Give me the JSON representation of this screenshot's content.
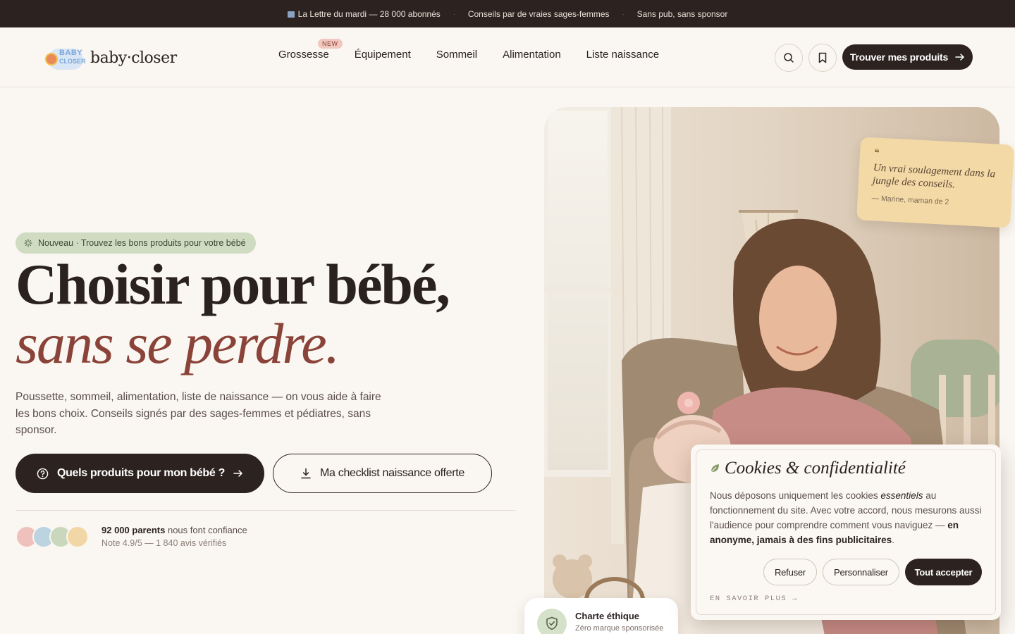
{
  "topbar": {
    "item1": "La Lettre du mardi — 28 000 abonnés",
    "item2": "Conseils par de vraies sages-femmes",
    "item3": "Sans pub, sans sponsor"
  },
  "brand": {
    "name": "baby·closer",
    "mark_line1": "BABY",
    "mark_line2": "CLOSER"
  },
  "nav": {
    "items": [
      "Grossesse",
      "Équipement",
      "Sommeil",
      "Alimentation",
      "Liste naissance"
    ],
    "badge": "NEW"
  },
  "header": {
    "cta": "Trouver mes produits",
    "search_icon": "search-icon",
    "bookmark_icon": "bookmark-icon"
  },
  "hero": {
    "pill": "Nouveau · Trouvez les bons produits pour votre bébé",
    "title_line1": "Choisir pour bébé,",
    "title_line2": "sans se perdre.",
    "lead": "Poussette, sommeil, alimentation, liste de naissance — on vous aide à faire les bons choix. Conseils signés par des sages-femmes et pédiatres, sans sponsor.",
    "cta_primary": "Quels produits pour mon bébé ?",
    "cta_secondary": "Ma checklist naissance offerte",
    "trust_count": "92 000 parents",
    "trust_text": "nous font confiance",
    "rating": "Note 4.9/5 — 1 840 avis vérifiés",
    "avatar_colors": [
      "#efc1bc",
      "#bcd3e0",
      "#c9d8bd",
      "#f2d7a6"
    ]
  },
  "quote": {
    "mark": "❝",
    "text": "Un vrai soulagement dans la jungle des conseils.",
    "author": "— Marine, maman de 2"
  },
  "ethic": {
    "title": "Charte éthique",
    "subtitle": "Zéro marque sponsorisée"
  },
  "cookie": {
    "title": "Cookies & confidentialité",
    "body_1": "Nous déposons uniquement les cookies ",
    "body_em": "essentiels",
    "body_2": " au fonctionnement du site. Avec votre accord, nous mesurons aussi l'audience pour comprendre comment vous naviguez — ",
    "body_strong": "en anonyme, jamais à des fins publicitaires",
    "body_3": ".",
    "refuse": "Refuser",
    "customize": "Personnaliser",
    "accept": "Tout accepter",
    "learn_more": "EN SAVOIR PLUS →"
  },
  "colors": {
    "accent": "#8a4338",
    "dark": "#2c2320",
    "sage": "#cfdcc1",
    "cream": "#faf6f1"
  }
}
